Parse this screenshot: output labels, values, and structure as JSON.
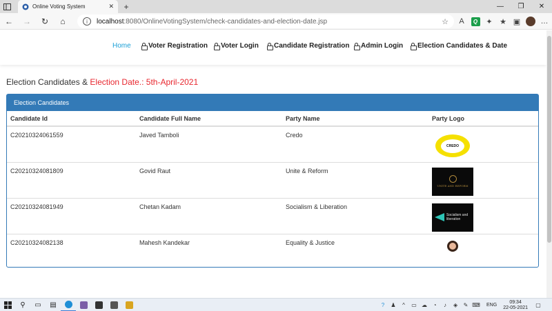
{
  "browser": {
    "tab_title": "Online Voting System",
    "tab_close": "✕",
    "new_tab": "+",
    "url_host": "localhost",
    "url_rest": ":8080/OnlineVotingSystem/check-candidates-and-election-date.jsp"
  },
  "nav": {
    "home": "Home",
    "voter_registration": "Voter Registration",
    "voter_login": "Voter Login",
    "candidate_registration": "Candidate Registration",
    "admin_login": "Admin Login",
    "election_candidates_date": "Election Candidates & Date"
  },
  "page": {
    "heading_prefix": "Election Candidates & ",
    "heading_date": "Election Date.: 5th-April-2021",
    "panel_title": "Election Candidates"
  },
  "table": {
    "headers": [
      "Candidate Id",
      "Candidate Full Name",
      "Party Name",
      "Party Logo"
    ],
    "rows": [
      {
        "id": "C20210324061559",
        "name": "Javed Tamboli",
        "party": "Credo",
        "logo_text": "CREDO"
      },
      {
        "id": "C20210324081809",
        "name": "Govid Raut",
        "party": "Unite & Reform",
        "logo_text": "UNITE AND REFORM"
      },
      {
        "id": "C20210324081949",
        "name": "Chetan Kadam",
        "party": "Socialism & Liberation",
        "logo_text": "Socialism and liberation"
      },
      {
        "id": "C20210324082138",
        "name": "Mahesh Kandekar",
        "party": "Equality & Justice",
        "logo_text": ""
      }
    ]
  },
  "taskbar": {
    "lang": "ENG",
    "time": "09:34",
    "date": "22-05-2021"
  },
  "colors": {
    "accent": "#337ab7",
    "active_nav": "#1a9fd6",
    "date_red": "#e8262e"
  }
}
